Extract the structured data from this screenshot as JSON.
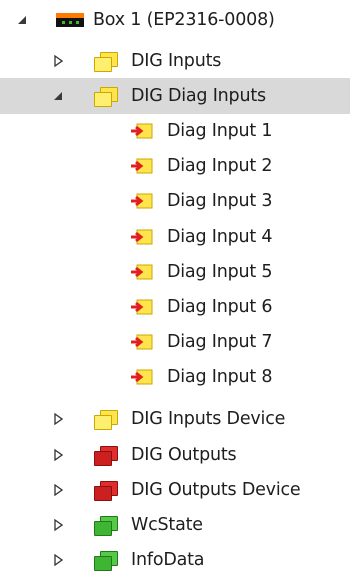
{
  "tree": {
    "box": {
      "label": "Box 1 (EP2316-0008)",
      "icon": "box-device-icon",
      "expanded": true
    },
    "nodes": [
      {
        "label": "DIG Inputs",
        "icon": "yellow-folder-icon",
        "expanded": false
      },
      {
        "label": "DIG Diag Inputs",
        "icon": "yellow-folder-icon",
        "expanded": true,
        "selected": true
      },
      {
        "label": "DIG Inputs Device",
        "icon": "yellow-folder-icon",
        "expanded": false
      },
      {
        "label": "DIG Outputs",
        "icon": "red-folder-icon",
        "expanded": false
      },
      {
        "label": "DIG Outputs Device",
        "icon": "red-folder-icon",
        "expanded": false
      },
      {
        "label": "WcState",
        "icon": "green-folder-icon",
        "expanded": false
      },
      {
        "label": "InfoData",
        "icon": "green-folder-icon",
        "expanded": false
      }
    ],
    "diag_inputs": [
      "Diag Input 1",
      "Diag Input 2",
      "Diag Input 3",
      "Diag Input 4",
      "Diag Input 5",
      "Diag Input 6",
      "Diag Input 7",
      "Diag Input 8"
    ],
    "diag_input_icon": "input-variable-icon",
    "colors": {
      "selection": "#d9d9d9",
      "yellow_folder": "#ffe44d",
      "red_folder": "#e02e2e",
      "green_folder": "#56c84a",
      "box_orange": "#ff7a00"
    }
  }
}
